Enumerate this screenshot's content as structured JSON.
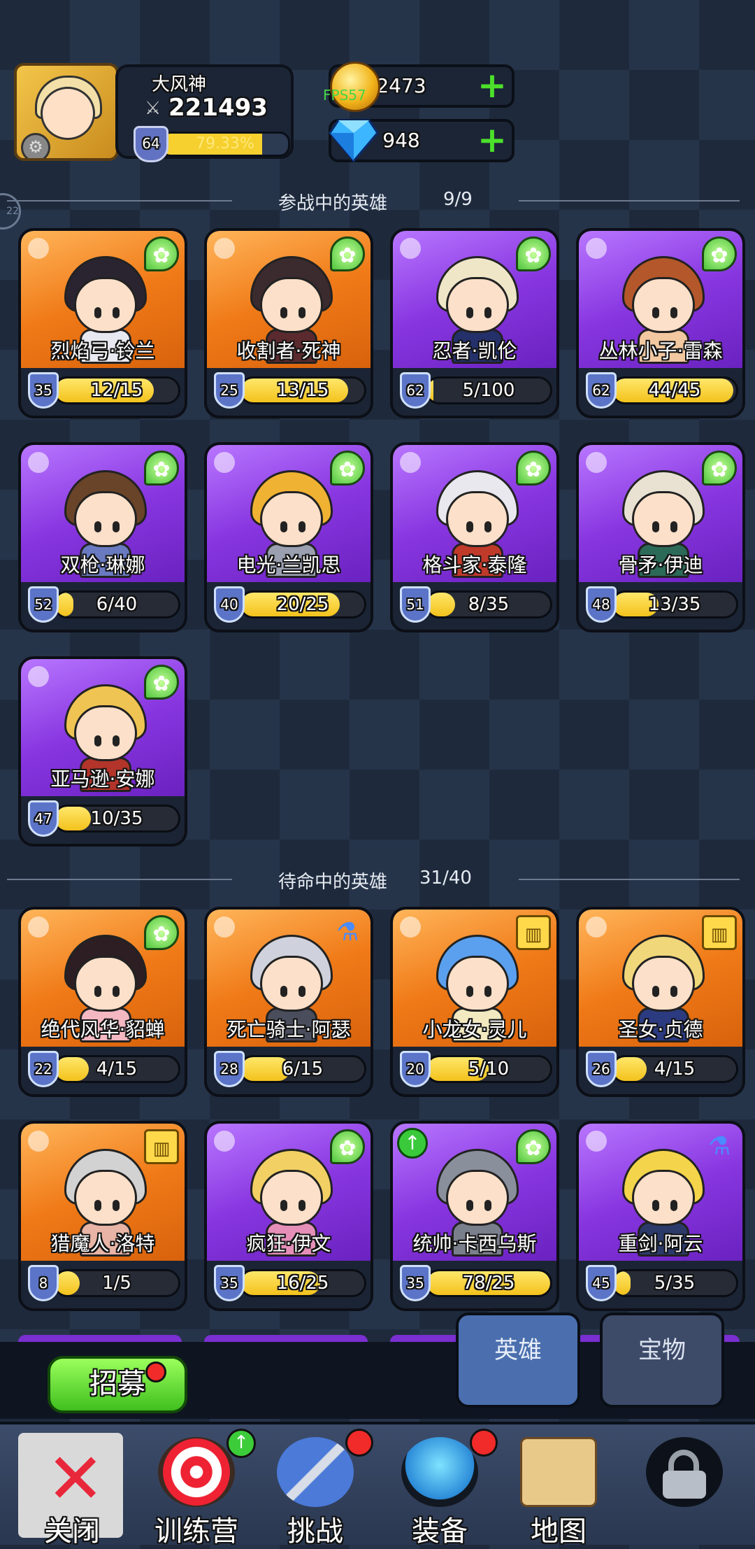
{
  "player": {
    "name": "大风神",
    "power": "221493",
    "level": "64",
    "xp_percent": "79.33%",
    "xp_fraction": 0.7933
  },
  "currency": {
    "gold": "2473",
    "gems": "948",
    "fps_label": "FPS57"
  },
  "side_badge": "22",
  "active_section": {
    "title": "参战中的英雄",
    "count": "9/9"
  },
  "active_heroes": [
    {
      "name": "烈焰弓·铃兰",
      "level": "35",
      "fragments": "12/15",
      "progress": 0.8,
      "bg": "orange",
      "badge": "wing",
      "hair": "#2a2430",
      "body": "#e8e8f0"
    },
    {
      "name": "收割者·死神",
      "level": "25",
      "fragments": "13/15",
      "progress": 0.87,
      "bg": "orange",
      "badge": "wing",
      "hair": "#3b2a2e",
      "body": "#5a2a2e"
    },
    {
      "name": "忍者·凯伦",
      "level": "62",
      "fragments": "5/100",
      "progress": 0.05,
      "bg": "purple",
      "badge": "wing",
      "hair": "#efe6c8",
      "body": "#24306a"
    },
    {
      "name": "丛林小子·雷森",
      "level": "62",
      "fragments": "44/45",
      "progress": 0.98,
      "bg": "purple",
      "badge": "wing",
      "hair": "#b4572a",
      "body": "#f2c8a0"
    },
    {
      "name": "双枪·琳娜",
      "level": "52",
      "fragments": "6/40",
      "progress": 0.15,
      "bg": "purple",
      "badge": "wing",
      "hair": "#6a4428",
      "body": "#6a7ac0"
    },
    {
      "name": "电光·兰凯思",
      "level": "40",
      "fragments": "20/25",
      "progress": 0.8,
      "bg": "purple",
      "badge": "wing",
      "hair": "#f0b232",
      "body": "#9aa0b0"
    },
    {
      "name": "格斗家·泰隆",
      "level": "51",
      "fragments": "8/35",
      "progress": 0.23,
      "bg": "purple",
      "badge": "wing",
      "hair": "#e8e8ee",
      "body": "#c03a2a"
    },
    {
      "name": "骨矛·伊迪",
      "level": "48",
      "fragments": "13/35",
      "progress": 0.37,
      "bg": "purple",
      "badge": "wing",
      "hair": "#e9e2d2",
      "body": "#2c6a58"
    },
    {
      "name": "亚马逊·安娜",
      "level": "47",
      "fragments": "10/35",
      "progress": 0.29,
      "bg": "purple",
      "badge": "wing",
      "hair": "#f0c452",
      "body": "#b2342a"
    }
  ],
  "standby_section": {
    "title": "待命中的英雄",
    "count": "31/40"
  },
  "standby_heroes": [
    {
      "name": "绝代风华·貂蝉",
      "level": "22",
      "fragments": "4/15",
      "progress": 0.27,
      "bg": "orange",
      "badge": "wing",
      "hair": "#2c1e22",
      "body": "#f3b8c2"
    },
    {
      "name": "死亡骑士·阿瑟",
      "level": "28",
      "fragments": "6/15",
      "progress": 0.4,
      "bg": "orange",
      "badge": "potion",
      "hair": "#cfd2dc",
      "body": "#4a4d5c"
    },
    {
      "name": "小龙女·灵儿",
      "level": "20",
      "fragments": "5/10",
      "progress": 0.5,
      "bg": "orange",
      "badge": "book",
      "hair": "#5aa0ee",
      "body": "#f2e9c0"
    },
    {
      "name": "圣女·贞德",
      "level": "26",
      "fragments": "4/15",
      "progress": 0.27,
      "bg": "orange",
      "badge": "book",
      "hair": "#f0d77a",
      "body": "#2c3a80"
    },
    {
      "name": "猎魔人·洛特",
      "level": "8",
      "fragments": "1/5",
      "progress": 0.2,
      "bg": "orange",
      "badge": "book",
      "hair": "#d2d2d2",
      "body": "#e8b4a6"
    },
    {
      "name": "疯狂·伊文",
      "level": "35",
      "fragments": "16/25",
      "progress": 0.64,
      "bg": "purple",
      "badge": "wing",
      "hair": "#f2d064",
      "body": "#e58fb8"
    },
    {
      "name": "统帅·卡西乌斯",
      "level": "35",
      "fragments": "78/25",
      "progress": 1.0,
      "bg": "purple",
      "badge": "wing",
      "hair": "#8a8f9c",
      "body": "#7a7f8c",
      "upgrade": true
    },
    {
      "name": "重剑·阿云",
      "level": "45",
      "fragments": "5/35",
      "progress": 0.14,
      "bg": "purple",
      "badge": "potion",
      "hair": "#f4d44a",
      "body": "#2c3a6a"
    }
  ],
  "bottom": {
    "recruit": "招募",
    "tab_heroes": "英雄",
    "tab_treasure": "宝物"
  },
  "nav": {
    "close": "关闭",
    "training": "训练营",
    "challenge": "挑战",
    "equipment": "装备",
    "map": "地图"
  }
}
